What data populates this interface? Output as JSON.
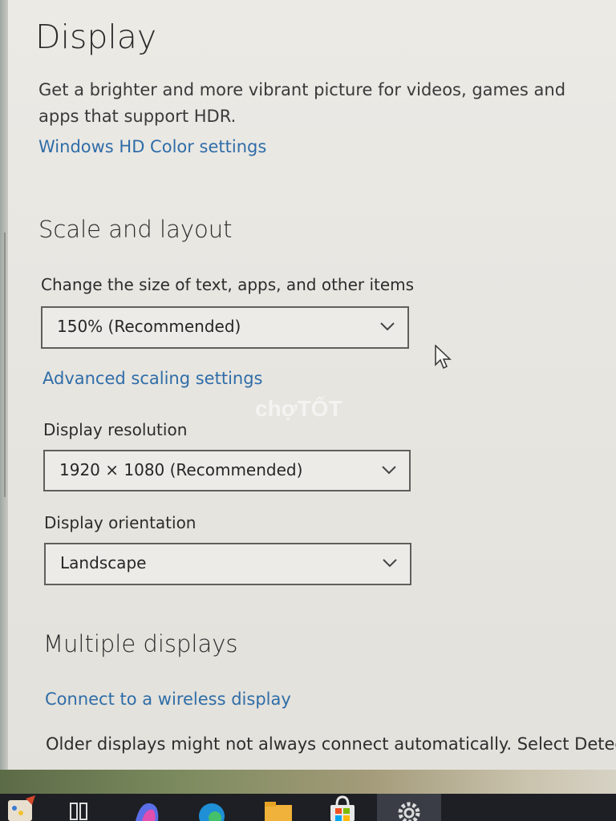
{
  "page": {
    "title": "Display",
    "hdr_description": "Get a brighter and more vibrant picture for videos, games and apps that support HDR.",
    "hdr_link": "Windows HD Color settings"
  },
  "scale_layout": {
    "heading": "Scale and layout",
    "scale_label": "Change the size of text, apps, and other items",
    "scale_value": "150% (Recommended)",
    "advanced_link": "Advanced scaling settings",
    "resolution_label": "Display resolution",
    "resolution_value": "1920 × 1080 (Recommended)",
    "orientation_label": "Display orientation",
    "orientation_value": "Landscape"
  },
  "multiple_displays": {
    "heading": "Multiple displays",
    "wireless_link": "Connect to a wireless display",
    "older_text": "Older displays might not always connect automatically. Select Detect"
  },
  "watermark": "chợTỐT",
  "taskbar": {
    "items": [
      "paint-icon",
      "task-view-icon",
      "copilot-icon",
      "edge-icon",
      "file-explorer-icon",
      "microsoft-store-icon",
      "settings-gear-icon"
    ]
  },
  "colors": {
    "link": "#2f6da8",
    "background": "#e8e6e1",
    "taskbar": "#1d1f24"
  }
}
